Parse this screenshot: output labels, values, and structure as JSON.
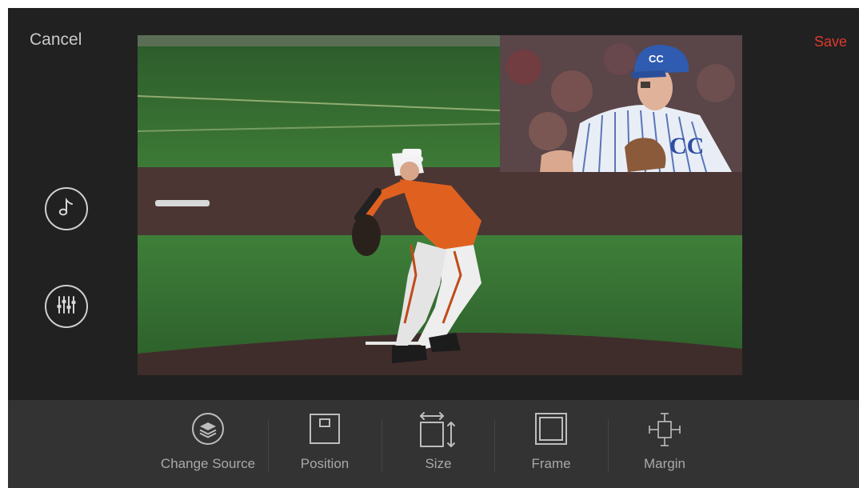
{
  "header": {
    "cancel_label": "Cancel",
    "save_label": "Save"
  },
  "side_controls": [
    {
      "icon": "music-note-icon"
    },
    {
      "icon": "mixer-sliders-icon"
    }
  ],
  "toolbar": {
    "items": [
      {
        "label": "Change Source",
        "icon": "layers-icon"
      },
      {
        "label": "Position",
        "icon": "position-icon"
      },
      {
        "label": "Size",
        "icon": "resize-icon"
      },
      {
        "label": "Frame",
        "icon": "frame-icon"
      },
      {
        "label": "Margin",
        "icon": "margin-icon"
      }
    ]
  },
  "colors": {
    "background": "#212121",
    "toolbar": "#333333",
    "accent_save": "#e0392e",
    "text": "#c9c9c9"
  }
}
